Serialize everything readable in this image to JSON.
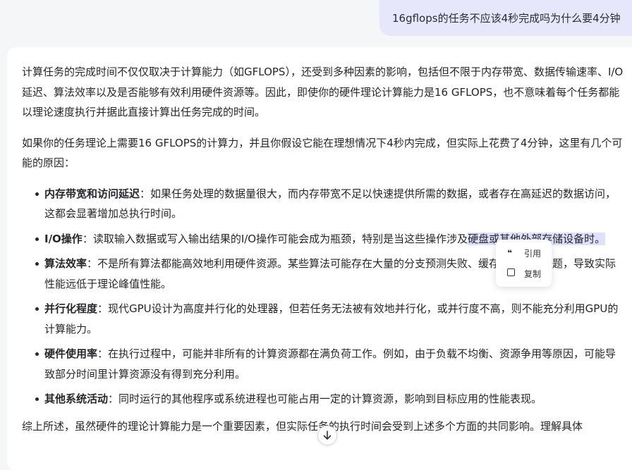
{
  "user_message": "16gflops的任务不应该4秒完成吗为什么要4分钟",
  "answer": {
    "intro": "计算任务的完成时间不仅仅取决于计算能力（如GFLOPS），还受到多种因素的影响，包括但不限于内存带宽、数据传输速率、I/O延迟、算法效率以及是否能够有效利用硬件资源等。因此，即使你的硬件理论计算能力是16 GFLOPS，也不意味着每个任务都能以理论速度执行并据此直接计算出任务完成的时间。",
    "lead": "如果你的任务理论上需要16 GFLOPS的计算力，并且你假设它能在理想情况下4秒内完成，但实际上花费了4分钟，这里有几个可能的原因：",
    "reasons": [
      {
        "term": "内存带宽和访问延迟",
        "text": "：如果任务处理的数据量很大，而内存带宽不足以快速提供所需的数据，或者存在高延迟的数据访问，这都会显著增加总执行时间。"
      },
      {
        "term": "I/O操作",
        "text": "：读取输入数据或写入输出结果的I/O操作可能会成为瓶颈，特别是当这些操作涉及",
        "text_selected": "硬盘或其他外部存储设备时。"
      },
      {
        "term": "算法效率",
        "text": "：不是所有算法都能高效地利用硬件资源。某些算法可能存在大量的分支预测失败、缓存未命中等问题，导致实际性能远低于理论峰值性能。"
      },
      {
        "term": "并行化程度",
        "text": "：现代GPU设计为高度并行化的处理器，但若任务无法被有效地并行化，或并行度不高，则不能充分利用GPU的计算能力。"
      },
      {
        "term": "硬件使用率",
        "text": "：在执行过程中，可能并非所有的计算资源都在满负荷工作。例如，由于负载不均衡、资源争用等原因，可能导致部分时间里计算资源没有得到充分利用。"
      },
      {
        "term": "其他系统活动",
        "text": "：同时运行的其他程序或系统进程也可能占用一定的计算资源，影响到目标应用的性能表现。"
      }
    ],
    "conclusion": "综上所述，虽然硬件的理论计算能力是一个重要因素，但实际任务的执行时间会受到上述多个方面的共同影响。理解具体"
  },
  "selection_popup": {
    "quote_label": "引用",
    "copy_label": "复制",
    "quote_icon": "quote-icon",
    "copy_icon": "copy-icon"
  },
  "scroll_button": {
    "icon": "arrow-down-icon"
  }
}
